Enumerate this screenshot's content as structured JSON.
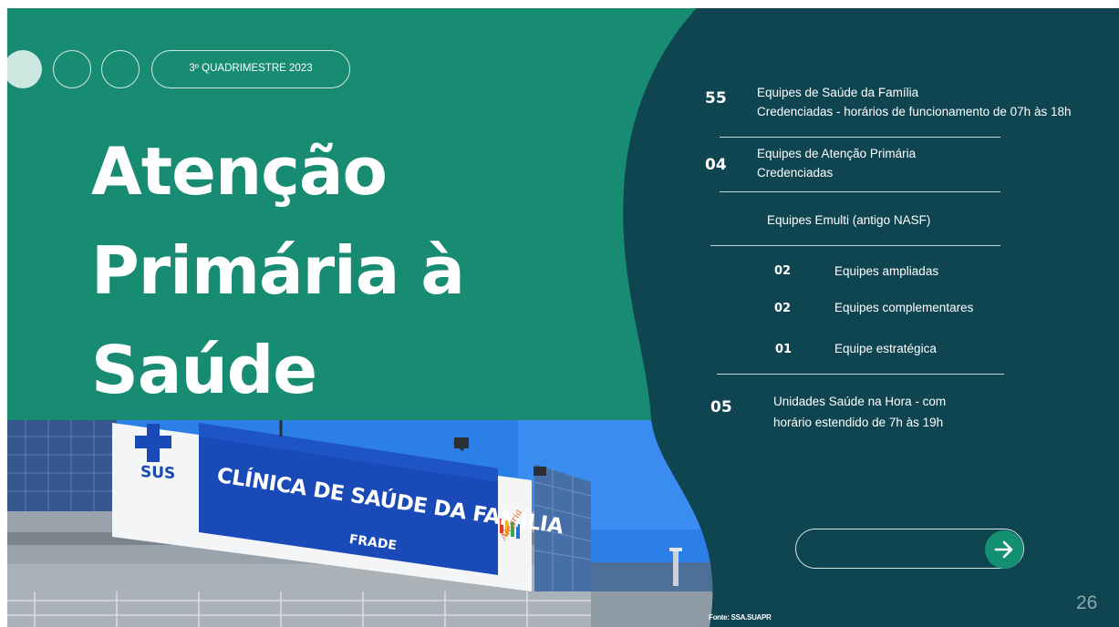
{
  "period_label": "3º QUADRIMESTRE 2023",
  "title_lines": [
    "Atenção",
    "Primária à",
    "Saúde"
  ],
  "stats": {
    "esf": {
      "number": "55",
      "line1": "Equipes de Saúde da Família",
      "line2": "Credenciadas - horários de funcionamento de 07h às 18h"
    },
    "eap": {
      "number": "04",
      "line1": "Equipes de Atenção Primária",
      "line2": "Credenciadas"
    },
    "emulti_heading": "Equipes Emulti (antigo NASF)",
    "emulti": [
      {
        "number": "02",
        "label": "Equipes ampliadas"
      },
      {
        "number": "02",
        "label": "Equipes complementares"
      },
      {
        "number": "01",
        "label": "Equipe estratégica"
      }
    ],
    "shh": {
      "number": "05",
      "line1": "Unidades Saúde na Hora - com",
      "line2": "horário estendido de 7h às 19h"
    }
  },
  "photo": {
    "sign_text": "CLÍNICA DE SAÚDE DA FAMÍLIA",
    "sign_subtext": "FRADE",
    "sus_logo_text": "SUS",
    "alegria_text": "Alegria"
  },
  "source": "Fonte: SSA.SUAPR",
  "page_number": "26",
  "colors": {
    "green": "#178c73",
    "dark_teal": "#0f4451",
    "sign_blue": "#1a49b8",
    "sky": "#2d7fe8"
  },
  "icons": {
    "cta": "arrow-right-icon"
  }
}
